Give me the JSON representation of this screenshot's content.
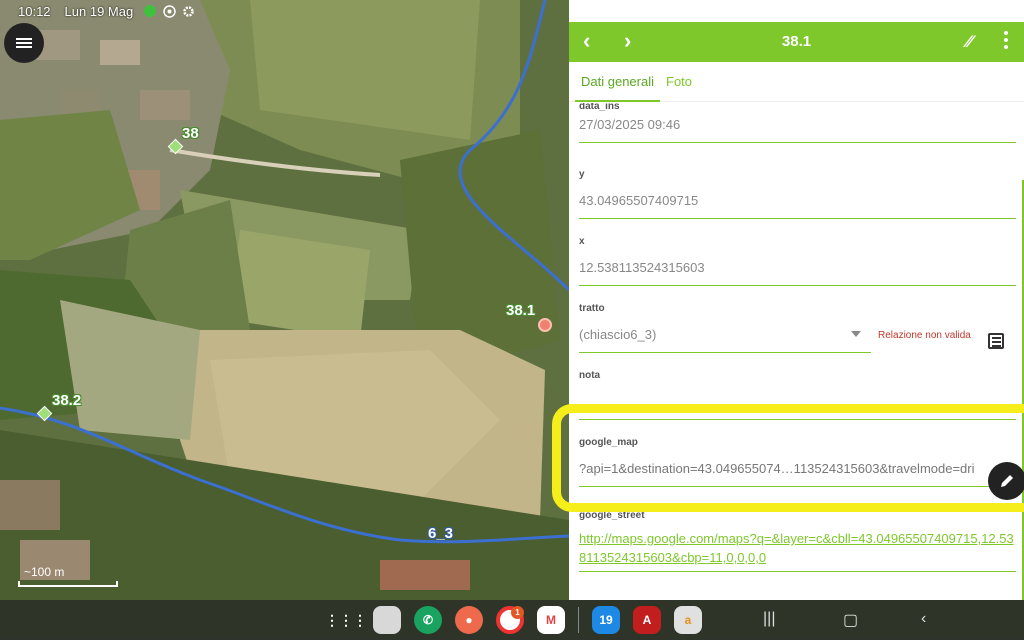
{
  "status_bar": {
    "time": "10:12",
    "date": "Lun 19 Mag",
    "icons": [
      "whatsapp-icon",
      "chrome-icon",
      "settings-icon"
    ],
    "right_icons": [
      "pen-icon",
      "mute-icon",
      "location-icon",
      "wifi-icon",
      "battery-icon"
    ]
  },
  "map": {
    "menu_icon": "menu-icon",
    "points": [
      {
        "label": "38"
      },
      {
        "label": "38.1"
      },
      {
        "label": "38.2"
      }
    ],
    "line_label": "6_3",
    "scale_label": "~100 m"
  },
  "panel": {
    "title": "38.1",
    "accent": "#7ec82c",
    "tabs": [
      "Dati generali",
      "Foto"
    ],
    "active_tab": "Dati generali",
    "fields": {
      "data_ins": {
        "label": "data_ins",
        "value": "27/03/2025 09:46"
      },
      "y": {
        "label": "y",
        "value": "43.04965507409715"
      },
      "x": {
        "label": "x",
        "value": "12.538113524315603"
      },
      "tratto": {
        "label": "tratto",
        "value": "(chiascio6_3)",
        "error": "Relazione non valida"
      },
      "nota": {
        "label": "nota",
        "value": ""
      },
      "google_map": {
        "label": "google_map",
        "value": "?api=1&destination=43.049655074…113524315603&travelmode=dri"
      },
      "google_street": {
        "label": "google_street",
        "value": "http://maps.google.com/maps?q=&layer=c&cbll=43.04965507409715,12.538113524315603&cbp=11,0,0,0,0"
      }
    }
  },
  "taskbar": {
    "apps": [
      {
        "name": "app-drawer",
        "color": "#444444"
      },
      {
        "name": "folder",
        "color": "#d8d8d8"
      },
      {
        "name": "phone",
        "color": "#1aa260"
      },
      {
        "name": "contacts",
        "color": "#ef6a4c"
      },
      {
        "name": "chrome",
        "color": "#ffffff",
        "badge": "1"
      },
      {
        "name": "gmail",
        "color": "#ffffff"
      },
      {
        "name": "calendar",
        "color": "#1e88e5",
        "text": "19"
      },
      {
        "name": "acrobat",
        "color": "#c21e1e"
      },
      {
        "name": "amazon",
        "color": "#e0e0e0"
      }
    ],
    "nav": [
      "recents-button",
      "home-button",
      "back-button"
    ]
  }
}
